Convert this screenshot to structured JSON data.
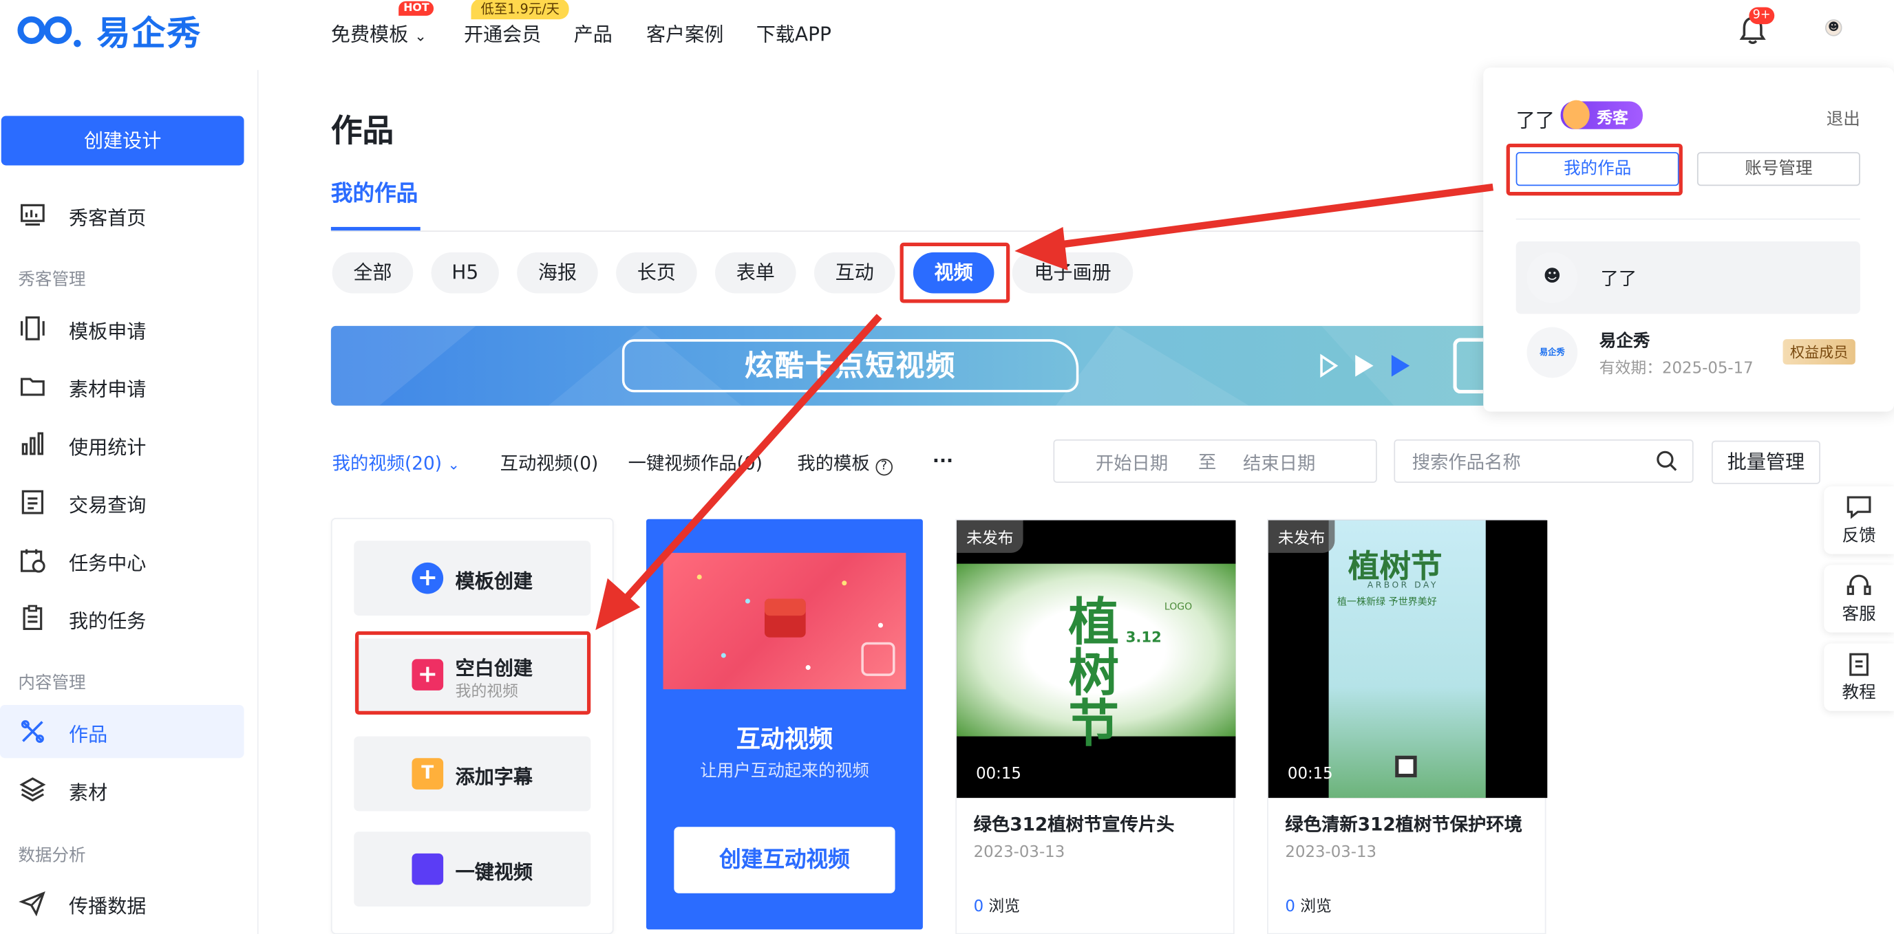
{
  "brand": {
    "name": "易企秀",
    "hot": "HOT"
  },
  "nav": {
    "items": [
      "免费模板",
      "开通会员",
      "产品",
      "客户案例",
      "下载APP"
    ],
    "member_badge": "低至1.9元/天",
    "notif_count": "9+"
  },
  "sidebar": {
    "create_label": "创建设计",
    "home": "秀客首页",
    "group_manage": "秀客管理",
    "manage_items": [
      "模板申请",
      "素材申请",
      "使用统计",
      "交易查询",
      "任务中心",
      "我的任务"
    ],
    "group_content": "内容管理",
    "content_items": [
      "作品",
      "素材"
    ],
    "group_data": "数据分析",
    "data_items": [
      "传播数据"
    ]
  },
  "main": {
    "title": "作品",
    "tab": "我的作品",
    "chips": [
      "全部",
      "H5",
      "海报",
      "长页",
      "表单",
      "互动",
      "视频",
      "电子画册"
    ],
    "active_chip": "视频",
    "banner_text": "炫酷卡点短视频",
    "filters": {
      "my_videos": "我的视频(20)",
      "interactive": "互动视频(0)",
      "oneclick": "一键视频作品(0)",
      "templates": "我的模板",
      "more": "···"
    },
    "date": {
      "start": "开始日期",
      "to": "至",
      "end": "结束日期"
    },
    "search_placeholder": "搜索作品名称",
    "batch": "批量管理"
  },
  "create_panel": {
    "template": "模板创建",
    "blank": "空白创建",
    "blank_sub": "我的视频",
    "subtitle": "添加字幕",
    "oneclick": "一键视频"
  },
  "interactive_card": {
    "title": "互动视频",
    "subtitle": "让用户互动起来的视频",
    "button": "创建互动视频"
  },
  "videos": [
    {
      "status": "未发布",
      "duration": "00:15",
      "title": "绿色312植树节宣传片头",
      "date": "2023-03-13",
      "views": "0",
      "views_label": "浏览",
      "thumb_text": "植树节",
      "thumb_num": "3.12",
      "thumb_logo": "LOGO"
    },
    {
      "status": "未发布",
      "duration": "00:15",
      "title": "绿色清新312植树节保护环境",
      "date": "2023-03-13",
      "views": "0",
      "views_label": "浏览",
      "thumb_text": "植树节",
      "thumb_sub": "植一株新绿 予世界美好",
      "thumb_en": "ARBOR DAY"
    }
  ],
  "dropdown": {
    "username": "了了",
    "badge": "秀客",
    "logout": "退出",
    "my_works": "我的作品",
    "account_mgmt": "账号管理",
    "accounts": [
      {
        "name": "了了"
      },
      {
        "name": "易企秀",
        "valid": "有效期：2025-05-17",
        "tag": "权益成员",
        "logo": "易企秀"
      }
    ]
  },
  "float": [
    "反馈",
    "客服",
    "教程"
  ],
  "colors": {
    "accent": "#2b6cff",
    "highlight": "#e8322a"
  }
}
